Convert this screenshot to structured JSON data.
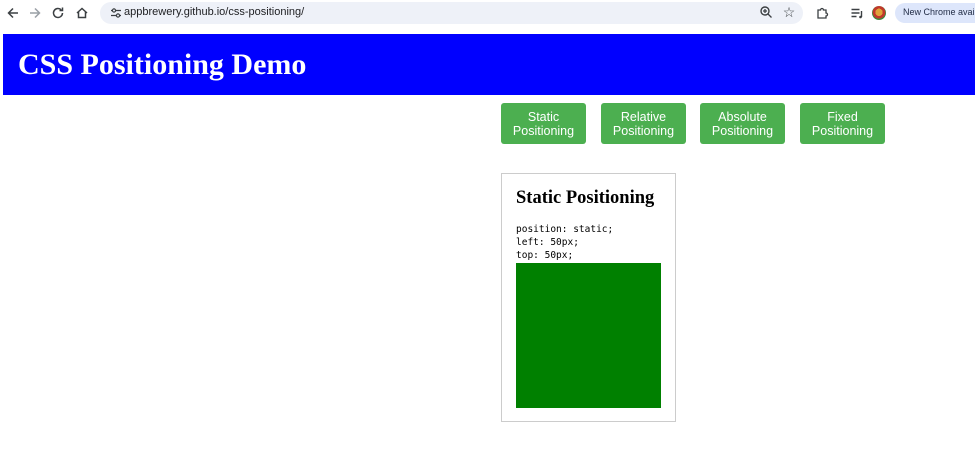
{
  "browser": {
    "url": "appbrewery.github.io/css-positioning/",
    "update_label": "New Chrome available"
  },
  "header": {
    "title": "CSS Positioning Demo",
    "bg_color": "#0000ff"
  },
  "nav": {
    "buttons": [
      {
        "label": "Static Positioning"
      },
      {
        "label": "Relative Positioning"
      },
      {
        "label": "Absolute Positioning"
      },
      {
        "label": "Fixed Positioning"
      }
    ],
    "button_color": "#4caf50"
  },
  "demo": {
    "title": "Static Positioning",
    "code": [
      "position: static;",
      "left: 50px;",
      "top: 50px;"
    ],
    "box_color": "#008000"
  }
}
